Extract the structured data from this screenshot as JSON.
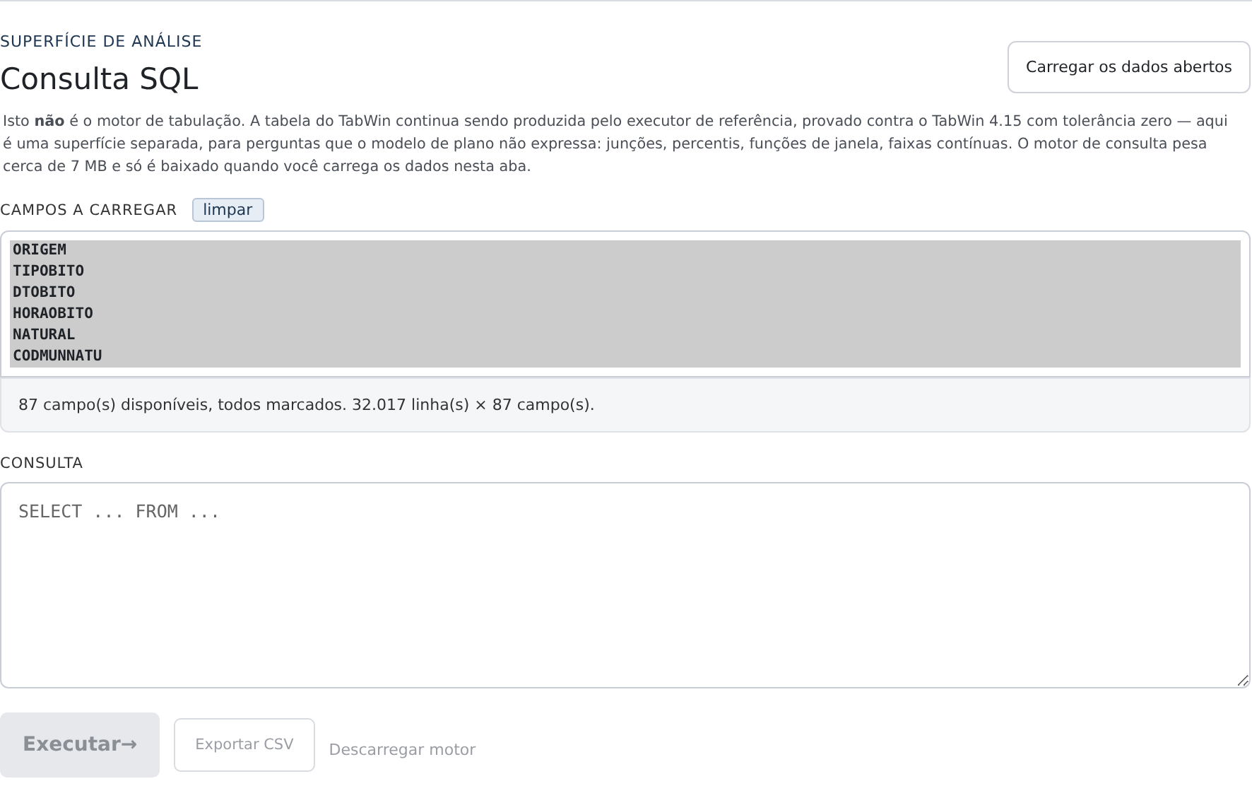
{
  "header": {
    "eyebrow": "SUPERFÍCIE DE ANÁLISE",
    "title": "Consulta SQL",
    "load_button": "Carregar os dados abertos"
  },
  "description": "Isto **não** é o motor de tabulação. A tabela do TabWin continua sendo produzida pelo executor de referência, provado contra o TabWin 4.15 com tolerância zero — aqui é uma superfície separada, para perguntas que o modelo de plano não expressa: junções, percentis, funções de janela, faixas contínuas. O motor de consulta pesa cerca de 7 MB e só é baixado quando você carrega os dados nesta aba.",
  "fields": {
    "label": "CAMPOS A CARREGAR",
    "clear_button": "limpar",
    "items": [
      {
        "name": "ORIGEM",
        "selected": true
      },
      {
        "name": "TIPOBITO",
        "selected": true
      },
      {
        "name": "DTOBITO",
        "selected": true
      },
      {
        "name": "HORAOBITO",
        "selected": true
      },
      {
        "name": "NATURAL",
        "selected": true
      },
      {
        "name": "CODMUNNATU",
        "selected": true
      }
    ],
    "status": "87 campo(s) disponíveis, todos marcados. 32.017 linha(s) × 87 campo(s)."
  },
  "query": {
    "label": "CONSULTA",
    "placeholder": "SELECT ... FROM ..."
  },
  "actions": [
    {
      "label": "Executar→",
      "kind": "primary",
      "disabled": true
    },
    {
      "label": "Exportar CSV",
      "kind": "outline",
      "disabled": true
    },
    {
      "label": "Descarregar motor",
      "kind": "link",
      "disabled": true
    }
  ]
}
